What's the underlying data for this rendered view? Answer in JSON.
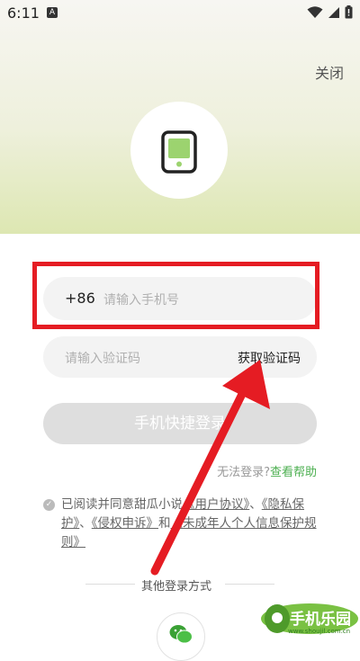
{
  "status_bar": {
    "time": "6:11",
    "notification_letter": "A"
  },
  "header": {
    "close_label": "关闭"
  },
  "form": {
    "country_code": "+86",
    "phone_placeholder": "请输入手机号",
    "code_placeholder": "请输入验证码",
    "get_code_label": "获取验证码",
    "login_button": "手机快捷登录"
  },
  "help": {
    "question": "无法登录?",
    "link": "查看帮助"
  },
  "agreement": {
    "prefix": "已阅读并同意甜瓜小说",
    "user_agreement": "《用户协议》",
    "sep1": "、",
    "privacy": "《隐私保护》",
    "sep2": "、",
    "infringement": "《侵权申诉》",
    "and": "和",
    "minors": "《未成年人个人信息保护规则》"
  },
  "other_login": {
    "label": "其他登录方式"
  },
  "watermark": {
    "name": "手机乐园",
    "url": "www.shoujil.com.cn"
  },
  "colors": {
    "accent_green": "#4caf50",
    "highlight_red": "#e51c23",
    "arrow_red": "#e51c23"
  }
}
